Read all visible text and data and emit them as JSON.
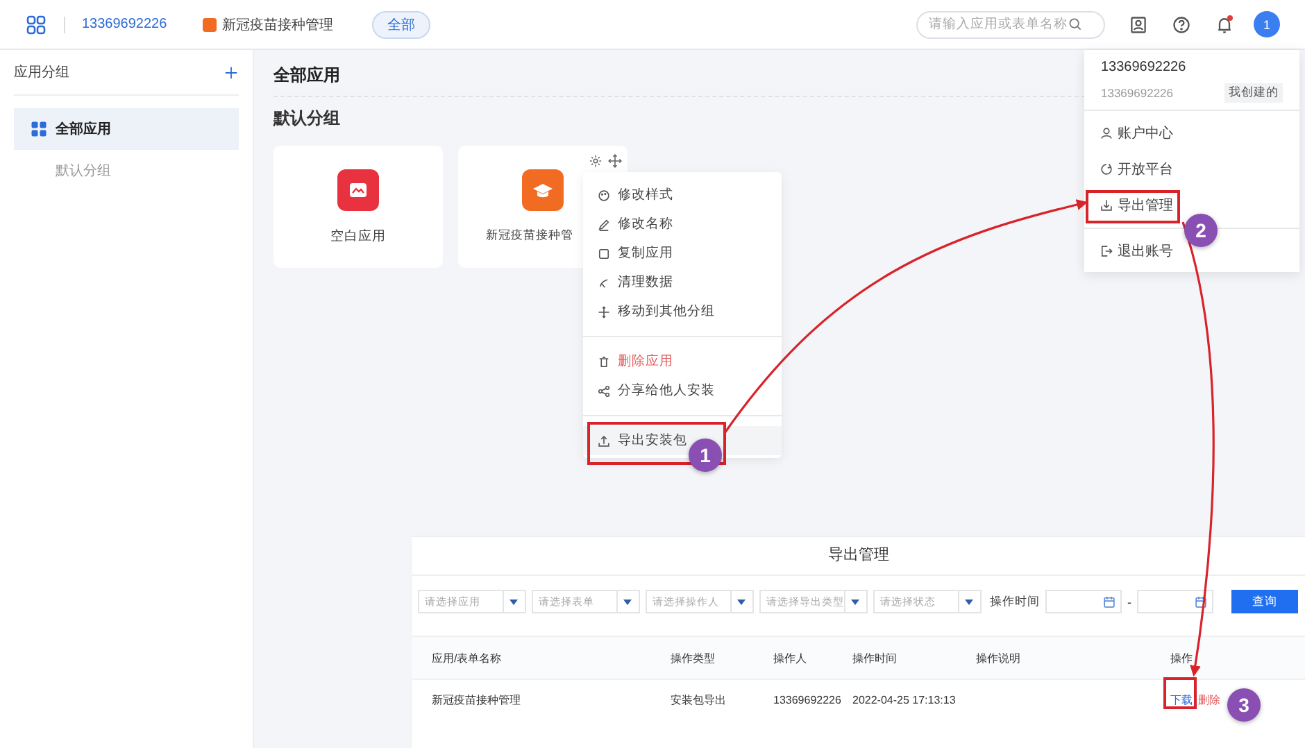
{
  "topbar": {
    "account": "13369692226",
    "current_app": "新冠疫苗接种管理",
    "scope": "全部",
    "search": {
      "placeholder": "请输入应用或表单名称"
    },
    "avatar": "1",
    "has_notification": true
  },
  "sidebar": {
    "title": "应用分组",
    "items": [
      {
        "label": "全部应用",
        "selected": true
      },
      {
        "label": "默认分组",
        "selected": false
      }
    ]
  },
  "main": {
    "title": "全部应用",
    "group_title": "默认分组",
    "apps": [
      {
        "name": "空白应用",
        "color": "#e8323f"
      },
      {
        "name": "新冠疫苗接种管",
        "color": "#f26b22"
      }
    ]
  },
  "context_menu": {
    "items": [
      {
        "label": "修改样式",
        "kind": "normal",
        "highlighted": false,
        "divider_above": false
      },
      {
        "label": "修改名称",
        "kind": "normal",
        "highlighted": false,
        "divider_above": false
      },
      {
        "label": "复制应用",
        "kind": "normal",
        "highlighted": false,
        "divider_above": false
      },
      {
        "label": "清理数据",
        "kind": "normal",
        "highlighted": false,
        "divider_above": false
      },
      {
        "label": "移动到其他分组",
        "kind": "normal",
        "highlighted": false,
        "divider_above": false
      },
      {
        "label": "删除应用",
        "kind": "danger",
        "highlighted": false,
        "divider_above": true
      },
      {
        "label": "分享给他人安装",
        "kind": "normal",
        "highlighted": false,
        "divider_above": false
      },
      {
        "label": "导出安装包",
        "kind": "normal",
        "highlighted": true,
        "divider_above": true
      }
    ]
  },
  "user_menu": {
    "name": "13369692226",
    "account": "13369692226",
    "tag": "我创建的",
    "items": [
      {
        "label": "账户中心",
        "divider_above": false
      },
      {
        "label": "开放平台",
        "divider_above": false
      },
      {
        "label": "导出管理",
        "divider_above": false
      },
      {
        "label": "退出账号",
        "divider_above": true
      }
    ]
  },
  "export_panel": {
    "title": "导出管理",
    "filters": [
      {
        "placeholder": "请选择应用"
      },
      {
        "placeholder": "请选择表单"
      },
      {
        "placeholder": "请选择操作人"
      },
      {
        "placeholder": "请选择导出类型"
      },
      {
        "placeholder": "请选择状态"
      }
    ],
    "time_label": "操作时间",
    "range_separator": "-",
    "query_button": "查询",
    "columns": [
      "应用/表单名称",
      "操作类型",
      "操作人",
      "操作时间",
      "操作说明",
      "操作"
    ],
    "rows": [
      {
        "cells": [
          "新冠疫苗接种管理",
          "安装包导出",
          "13369692226",
          "2022-04-25 17:13:13",
          null
        ],
        "actions": [
          "下载",
          "删除"
        ]
      }
    ]
  },
  "annotations": {
    "steps": [
      "1",
      "2",
      "3"
    ]
  }
}
